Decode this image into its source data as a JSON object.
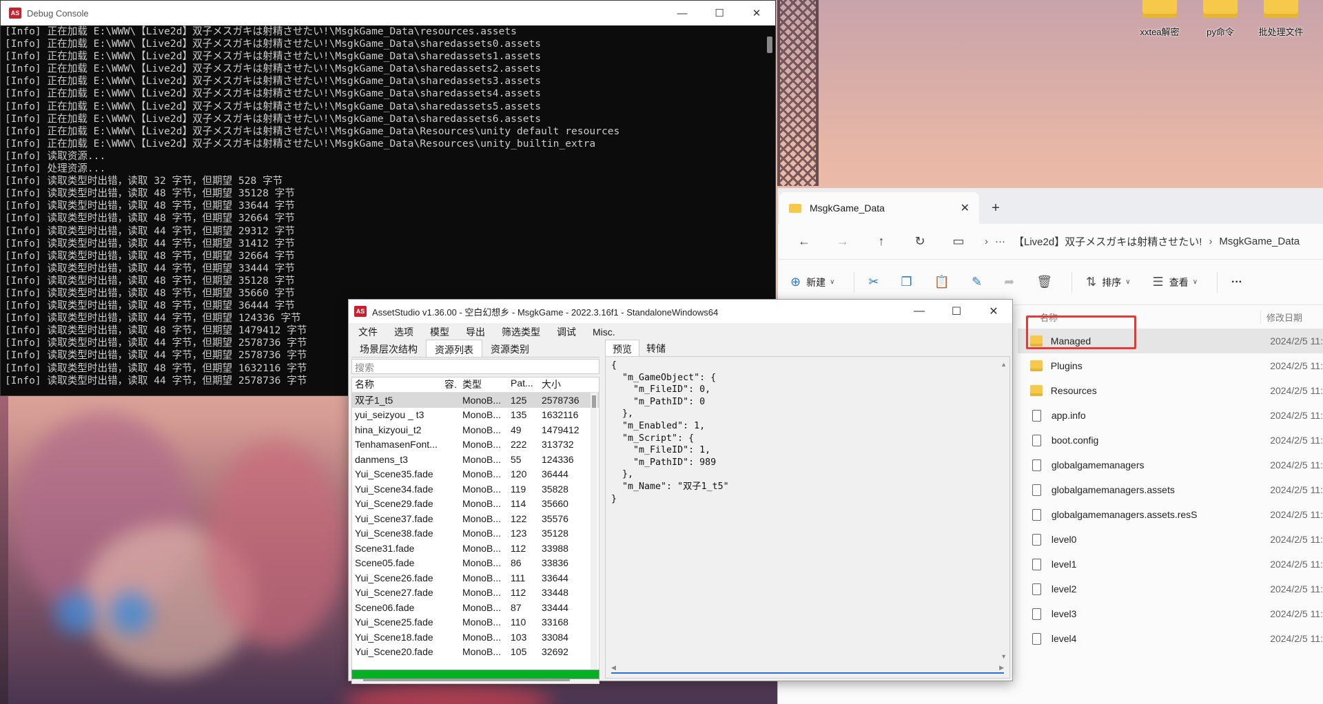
{
  "desktop": {
    "icons": [
      {
        "label": "xxtea解密"
      },
      {
        "label": "py命令"
      },
      {
        "label": "批处理文件"
      }
    ]
  },
  "console": {
    "title": "Debug Console",
    "lines": [
      "[Info] 正在加载 E:\\WWW\\【Live2d】双子メスガキは射精させたい!\\MsgkGame_Data\\resources.assets",
      "[Info] 正在加载 E:\\WWW\\【Live2d】双子メスガキは射精させたい!\\MsgkGame_Data\\sharedassets0.assets",
      "[Info] 正在加载 E:\\WWW\\【Live2d】双子メスガキは射精させたい!\\MsgkGame_Data\\sharedassets1.assets",
      "[Info] 正在加载 E:\\WWW\\【Live2d】双子メスガキは射精させたい!\\MsgkGame_Data\\sharedassets2.assets",
      "[Info] 正在加载 E:\\WWW\\【Live2d】双子メスガキは射精させたい!\\MsgkGame_Data\\sharedassets3.assets",
      "[Info] 正在加载 E:\\WWW\\【Live2d】双子メスガキは射精させたい!\\MsgkGame_Data\\sharedassets4.assets",
      "[Info] 正在加载 E:\\WWW\\【Live2d】双子メスガキは射精させたい!\\MsgkGame_Data\\sharedassets5.assets",
      "[Info] 正在加载 E:\\WWW\\【Live2d】双子メスガキは射精させたい!\\MsgkGame_Data\\sharedassets6.assets",
      "[Info] 正在加载 E:\\WWW\\【Live2d】双子メスガキは射精させたい!\\MsgkGame_Data\\Resources\\unity default resources",
      "[Info] 正在加载 E:\\WWW\\【Live2d】双子メスガキは射精させたい!\\MsgkGame_Data\\Resources\\unity_builtin_extra",
      "[Info] 读取资源...",
      "[Info] 处理资源...",
      "[Info] 读取类型时出错，读取 32 字节，但期望 528 字节",
      "[Info] 读取类型时出错，读取 48 字节，但期望 35128 字节",
      "[Info] 读取类型时出错，读取 48 字节，但期望 33644 字节",
      "[Info] 读取类型时出错，读取 48 字节，但期望 32664 字节",
      "[Info] 读取类型时出错，读取 44 字节，但期望 29312 字节",
      "[Info] 读取类型时出错，读取 44 字节，但期望 31412 字节",
      "[Info] 读取类型时出错，读取 48 字节，但期望 32664 字节",
      "[Info] 读取类型时出错，读取 44 字节，但期望 33444 字节",
      "[Info] 读取类型时出错，读取 48 字节，但期望 35128 字节",
      "[Info] 读取类型时出错，读取 48 字节，但期望 35660 字节",
      "[Info] 读取类型时出错，读取 48 字节，但期望 36444 字节",
      "[Info] 读取类型时出错，读取 44 字节，但期望 124336 字节",
      "[Info] 读取类型时出错，读取 48 字节，但期望 1479412 字节",
      "[Info] 读取类型时出错，读取 44 字节，但期望 2578736 字节",
      "[Info] 读取类型时出错，读取 44 字节，但期望 2578736 字节",
      "[Info] 读取类型时出错，读取 48 字节，但期望 1632116 字节",
      "[Info] 读取类型时出错，读取 44 字节，但期望 2578736 字节"
    ]
  },
  "explorer": {
    "tab_title": "MsgkGame_Data",
    "breadcrumb": [
      "【Live2d】双子メスガキは射精させたい!",
      "MsgkGame_Data"
    ],
    "more_crumb": "···",
    "toolbar": {
      "new": "新建",
      "sort": "排序",
      "view": "查看",
      "more": "···"
    },
    "columns": {
      "name": "名称",
      "date": "修改日期"
    },
    "rows": [
      {
        "name": "Managed",
        "kind": "folder",
        "date": "2024/2/5 11:"
      },
      {
        "name": "Plugins",
        "kind": "folder",
        "date": "2024/2/5 11:"
      },
      {
        "name": "Resources",
        "kind": "folder",
        "date": "2024/2/5 11:"
      },
      {
        "name": "app.info",
        "kind": "file",
        "date": "2024/2/5 11:"
      },
      {
        "name": "boot.config",
        "kind": "file",
        "date": "2024/2/5 11:"
      },
      {
        "name": "globalgamemanagers",
        "kind": "file",
        "date": "2024/2/5 11:"
      },
      {
        "name": "globalgamemanagers.assets",
        "kind": "file",
        "date": "2024/2/5 11:"
      },
      {
        "name": "globalgamemanagers.assets.resS",
        "kind": "file",
        "date": "2024/2/5 11:"
      },
      {
        "name": "level0",
        "kind": "file",
        "date": "2024/2/5 11:"
      },
      {
        "name": "level1",
        "kind": "file",
        "date": "2024/2/5 11:"
      },
      {
        "name": "level2",
        "kind": "file",
        "date": "2024/2/5 11:"
      },
      {
        "name": "level3",
        "kind": "file",
        "date": "2024/2/5 11:"
      },
      {
        "name": "level4",
        "kind": "file",
        "date": "2024/2/5 11:"
      }
    ]
  },
  "asset_studio": {
    "title": "AssetStudio v1.36.00 - 空白幻想乡 - MsgkGame - 2022.3.16f1 - StandaloneWindows64",
    "menu": [
      "文件",
      "选项",
      "模型",
      "导出",
      "筛选类型",
      "调试",
      "Misc."
    ],
    "left_tabs": [
      "场景层次结构",
      "资源列表",
      "资源类别"
    ],
    "search_placeholder": "搜索",
    "columns": [
      "名称",
      "容.",
      "类型",
      "Pat...",
      "大小"
    ],
    "rows": [
      {
        "name": "双子1_t5",
        "c": "",
        "type": "MonoB...",
        "path": "125",
        "size": "2578736"
      },
      {
        "name": "yui_seizyou _ t3",
        "c": "",
        "type": "MonoB...",
        "path": "135",
        "size": "1632116"
      },
      {
        "name": "hina_kizyoui_t2",
        "c": "",
        "type": "MonoB...",
        "path": "49",
        "size": "1479412"
      },
      {
        "name": "TenhamasenFont...",
        "c": "",
        "type": "MonoB...",
        "path": "222",
        "size": "313732"
      },
      {
        "name": "danmens_t3",
        "c": "",
        "type": "MonoB...",
        "path": "55",
        "size": "124336"
      },
      {
        "name": "Yui_Scene35.fade",
        "c": "",
        "type": "MonoB...",
        "path": "120",
        "size": "36444"
      },
      {
        "name": "Yui_Scene34.fade",
        "c": "",
        "type": "MonoB...",
        "path": "119",
        "size": "35828"
      },
      {
        "name": "Yui_Scene29.fade",
        "c": "",
        "type": "MonoB...",
        "path": "114",
        "size": "35660"
      },
      {
        "name": "Yui_Scene37.fade",
        "c": "",
        "type": "MonoB...",
        "path": "122",
        "size": "35576"
      },
      {
        "name": "Yui_Scene38.fade",
        "c": "",
        "type": "MonoB...",
        "path": "123",
        "size": "35128"
      },
      {
        "name": "Scene31.fade",
        "c": "",
        "type": "MonoB...",
        "path": "112",
        "size": "33988"
      },
      {
        "name": "Scene05.fade",
        "c": "",
        "type": "MonoB...",
        "path": "86",
        "size": "33836"
      },
      {
        "name": "Yui_Scene26.fade",
        "c": "",
        "type": "MonoB...",
        "path": "111",
        "size": "33644"
      },
      {
        "name": "Yui_Scene27.fade",
        "c": "",
        "type": "MonoB...",
        "path": "112",
        "size": "33448"
      },
      {
        "name": "Scene06.fade",
        "c": "",
        "type": "MonoB...",
        "path": "87",
        "size": "33444"
      },
      {
        "name": "Yui_Scene25.fade",
        "c": "",
        "type": "MonoB...",
        "path": "110",
        "size": "33168"
      },
      {
        "name": "Yui_Scene18.fade",
        "c": "",
        "type": "MonoB...",
        "path": "103",
        "size": "33084"
      },
      {
        "name": "Yui_Scene20.fade",
        "c": "",
        "type": "MonoB...",
        "path": "105",
        "size": "32692"
      }
    ],
    "right_tabs": [
      "预览",
      "转储"
    ],
    "preview_text": "{\n  \"m_GameObject\": {\n    \"m_FileID\": 0,\n    \"m_PathID\": 0\n  },\n  \"m_Enabled\": 1,\n  \"m_Script\": {\n    \"m_FileID\": 1,\n    \"m_PathID\": 989\n  },\n  \"m_Name\": \"双子1_t5\"\n}",
    "progress": 1.0
  },
  "colors": {
    "progress": "#06b025",
    "highlight_box": "#e53935",
    "console_bg": "#0c0c0c"
  }
}
